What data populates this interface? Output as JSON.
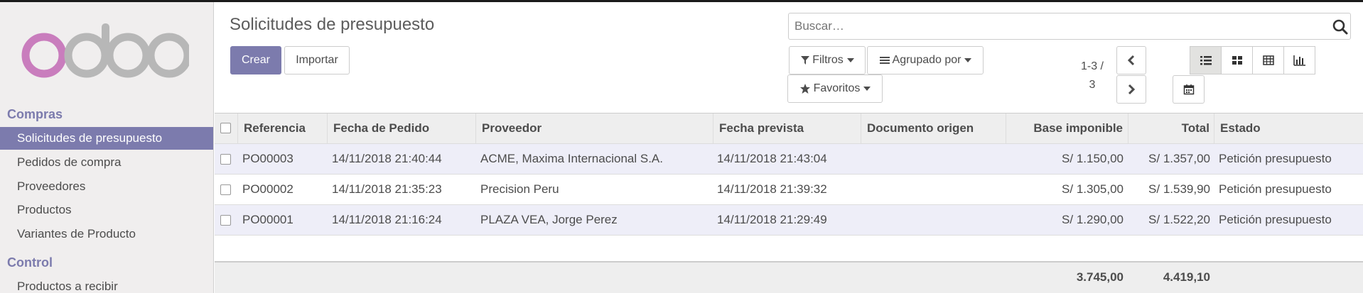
{
  "sidebar": {
    "sections": [
      {
        "title": "Compras",
        "items": [
          "Solicitudes de presupuesto",
          "Pedidos de compra",
          "Proveedores",
          "Productos",
          "Variantes de Producto"
        ]
      },
      {
        "title": "Control",
        "items": [
          "Productos a recibir"
        ]
      }
    ],
    "active_item": "Solicitudes de presupuesto"
  },
  "header": {
    "title": "Solicitudes de presupuesto",
    "create_label": "Crear",
    "import_label": "Importar"
  },
  "search": {
    "placeholder": "Buscar…",
    "value": ""
  },
  "filters": {
    "filters_label": "Filtros",
    "groupby_label": "Agrupado por",
    "favorites_label": "Favoritos"
  },
  "pager": {
    "range": "1-3 /",
    "total": "3"
  },
  "views": [
    "list",
    "kanban",
    "pivot",
    "graph",
    "calendar"
  ],
  "active_view": "list",
  "table": {
    "columns": [
      "Referencia",
      "Fecha de Pedido",
      "Proveedor",
      "Fecha prevista",
      "Documento origen",
      "Base imponible",
      "Total",
      "Estado"
    ],
    "rows": [
      [
        "PO00003",
        "14/11/2018 21:40:44",
        "ACME, Maxima Internacional S.A.",
        "14/11/2018 21:43:04",
        "",
        "S/ 1.150,00",
        "S/ 1.357,00",
        "Petición presupuesto"
      ],
      [
        "PO00002",
        "14/11/2018 21:35:23",
        "Precision Peru",
        "14/11/2018 21:39:32",
        "",
        "S/ 1.305,00",
        "S/ 1.539,90",
        "Petición presupuesto"
      ],
      [
        "PO00001",
        "14/11/2018 21:16:24",
        "PLAZA VEA, Jorge Perez",
        "14/11/2018 21:29:49",
        "",
        "S/ 1.290,00",
        "S/ 1.522,20",
        "Petición presupuesto"
      ]
    ],
    "totals": {
      "base": "3.745,00",
      "total": "4.419,10"
    }
  },
  "colors": {
    "brand": "#7c7bad",
    "row_alt": "#eeeef8",
    "sidebar_bg": "#f0eeee"
  }
}
